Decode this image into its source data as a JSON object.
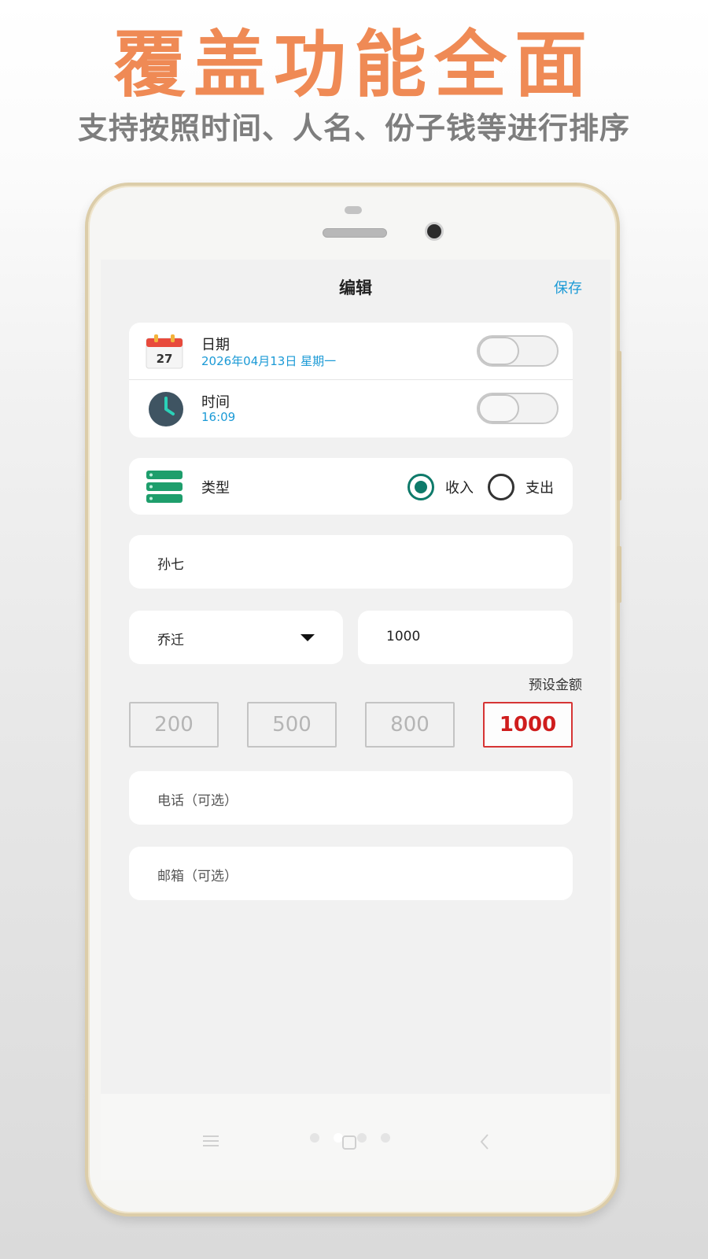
{
  "banner": {
    "title": "覆盖功能全面",
    "subtitle": "支持按照时间、人名、份子钱等进行排序"
  },
  "header": {
    "title": "编辑",
    "save_label": "保存"
  },
  "date_row": {
    "icon": "calendar-icon",
    "calendar_day": "27",
    "label": "日期",
    "value": "2026年04月13日 星期一",
    "toggle_on": false
  },
  "time_row": {
    "icon": "clock-icon",
    "label": "时间",
    "value": "16:09",
    "toggle_on": false
  },
  "type_row": {
    "icon": "list-icon",
    "label": "类型",
    "options": [
      {
        "label": "收入",
        "selected": true
      },
      {
        "label": "支出",
        "selected": false
      }
    ]
  },
  "name_field": {
    "value": "孙七"
  },
  "category_select": {
    "value": "乔迁"
  },
  "amount_field": {
    "value": "1000"
  },
  "presets": {
    "label": "预设金额",
    "values": [
      "200",
      "500",
      "800",
      "1000"
    ],
    "selected_index": 3
  },
  "phone_field": {
    "placeholder": "电话（可选）"
  },
  "email_field": {
    "placeholder": "邮箱（可选）"
  },
  "colors": {
    "accent_blue": "#1b9ad6",
    "banner_orange": "#ef8a55",
    "radio_teal": "#0e7a6a",
    "preset_red": "#cf1d1d"
  },
  "system_nav": {
    "icons": [
      "menu-icon",
      "home-icon",
      "back-icon"
    ]
  }
}
